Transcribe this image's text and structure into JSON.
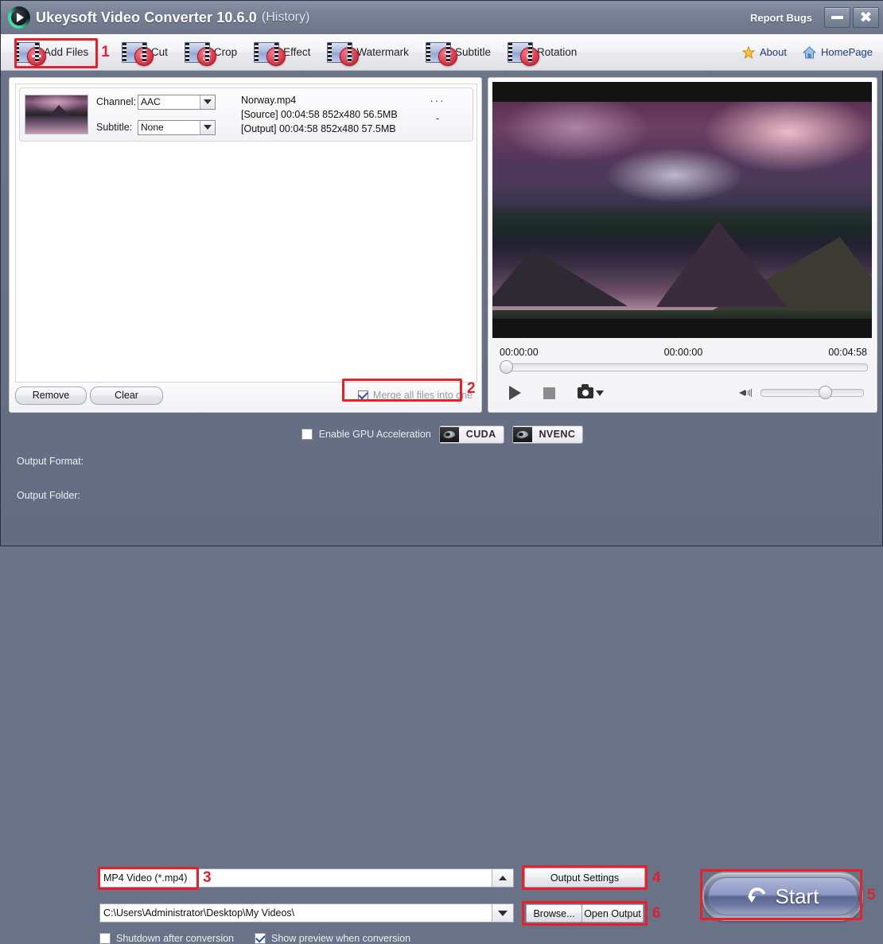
{
  "titlebar": {
    "app_title": "Ukeysoft Video Converter 10.6.0",
    "history_label": "(History)",
    "report_bugs": "Report Bugs",
    "minimize_icon": "minimize-icon",
    "close_icon": "close-icon",
    "logo_icon": "app-logo-play-icon"
  },
  "toolbar": {
    "items": [
      {
        "label": "Add Files",
        "icon": "film-plus-icon",
        "glyph": "+"
      },
      {
        "label": "Cut",
        "icon": "film-scissors-icon",
        "glyph": "✂"
      },
      {
        "label": "Crop",
        "icon": "film-crop-icon",
        "glyph": "⧉"
      },
      {
        "label": "Effect",
        "icon": "film-magic-wand-icon",
        "glyph": "✦"
      },
      {
        "label": "Watermark",
        "icon": "film-droplet-icon",
        "glyph": "●"
      },
      {
        "label": "Subtitle",
        "icon": "film-text-icon",
        "glyph": "T"
      },
      {
        "label": "Rotation",
        "icon": "film-rotate-icon",
        "glyph": "↺"
      }
    ],
    "about": "About",
    "homepage": "HomePage",
    "about_icon": "star-icon",
    "homepage_icon": "home-icon"
  },
  "markers": {
    "m1": "1",
    "m2": "2",
    "m3": "3",
    "m4": "4",
    "m5": "5",
    "m6": "6"
  },
  "filelist": {
    "row": {
      "channel_label": "Channel:",
      "channel_value": "AAC",
      "subtitle_label": "Subtitle:",
      "subtitle_value": "None",
      "filename": "Norway.mp4",
      "source_line": "[Source]  00:04:58  852x480  56.5MB",
      "output_line": "[Output]  00:04:58  852x480  57.5MB",
      "more_dots": "···",
      "dash": "-",
      "thumbnail_icon": "video-thumbnail"
    },
    "remove_label": "Remove",
    "clear_label": "Clear",
    "merge_label": "Merge all files into one",
    "merge_checked": true
  },
  "player": {
    "preview_icon": "video-preview",
    "time_start": "00:00:00",
    "time_current": "00:00:00",
    "time_total": "00:04:58",
    "play_icon": "play-icon",
    "stop_icon": "stop-icon",
    "snapshot_icon": "camera-icon",
    "snapshot_caret_icon": "caret-down-icon",
    "volume_icon": "speaker-icon",
    "seek_position_pct": 0,
    "volume_pct": 57
  },
  "footer": {
    "gpu_label": "Enable GPU Acceleration",
    "gpu_checked": false,
    "cuda_label": "CUDA",
    "nvenc_label": "NVENC",
    "nvidia_icon": "nvidia-eye-icon",
    "output_format_label": "Output Format:",
    "output_format_value": "MP4 Video (*.mp4)",
    "output_settings_label": "Output Settings",
    "start_label": "Start",
    "start_icon": "refresh-circle-icon",
    "output_folder_label": "Output Folder:",
    "output_folder_value": "C:\\Users\\Administrator\\Desktop\\My Videos\\",
    "browse_label": "Browse...",
    "open_output_label": "Open Output",
    "shutdown_label": "Shutdown after conversion",
    "shutdown_checked": false,
    "preview_label": "Show preview when conversion",
    "preview_checked": true
  },
  "colors": {
    "chrome": "#6d7589",
    "accent_red": "#e8202a",
    "link_blue": "#1b3f7a"
  }
}
